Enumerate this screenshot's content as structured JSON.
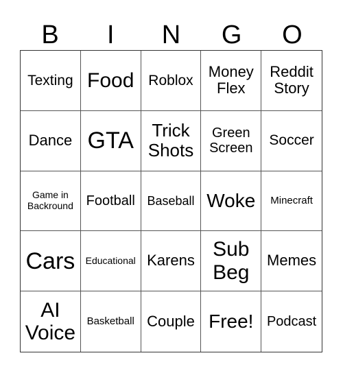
{
  "header": {
    "letters": [
      "B",
      "I",
      "N",
      "G",
      "O"
    ]
  },
  "cells": [
    "Texting",
    "Food",
    "Roblox",
    "Money Flex",
    "Reddit Story",
    "Dance",
    "GTA",
    "Trick Shots",
    "Green Screen",
    "Soccer",
    "Game in Backround",
    "Football",
    "Baseball",
    "Woke",
    "Minecraft",
    "Cars",
    "Educational",
    "Karens",
    "Sub Beg",
    "Memes",
    "AI Voice",
    "Basketball",
    "Couple",
    "Free!",
    "Podcast"
  ]
}
